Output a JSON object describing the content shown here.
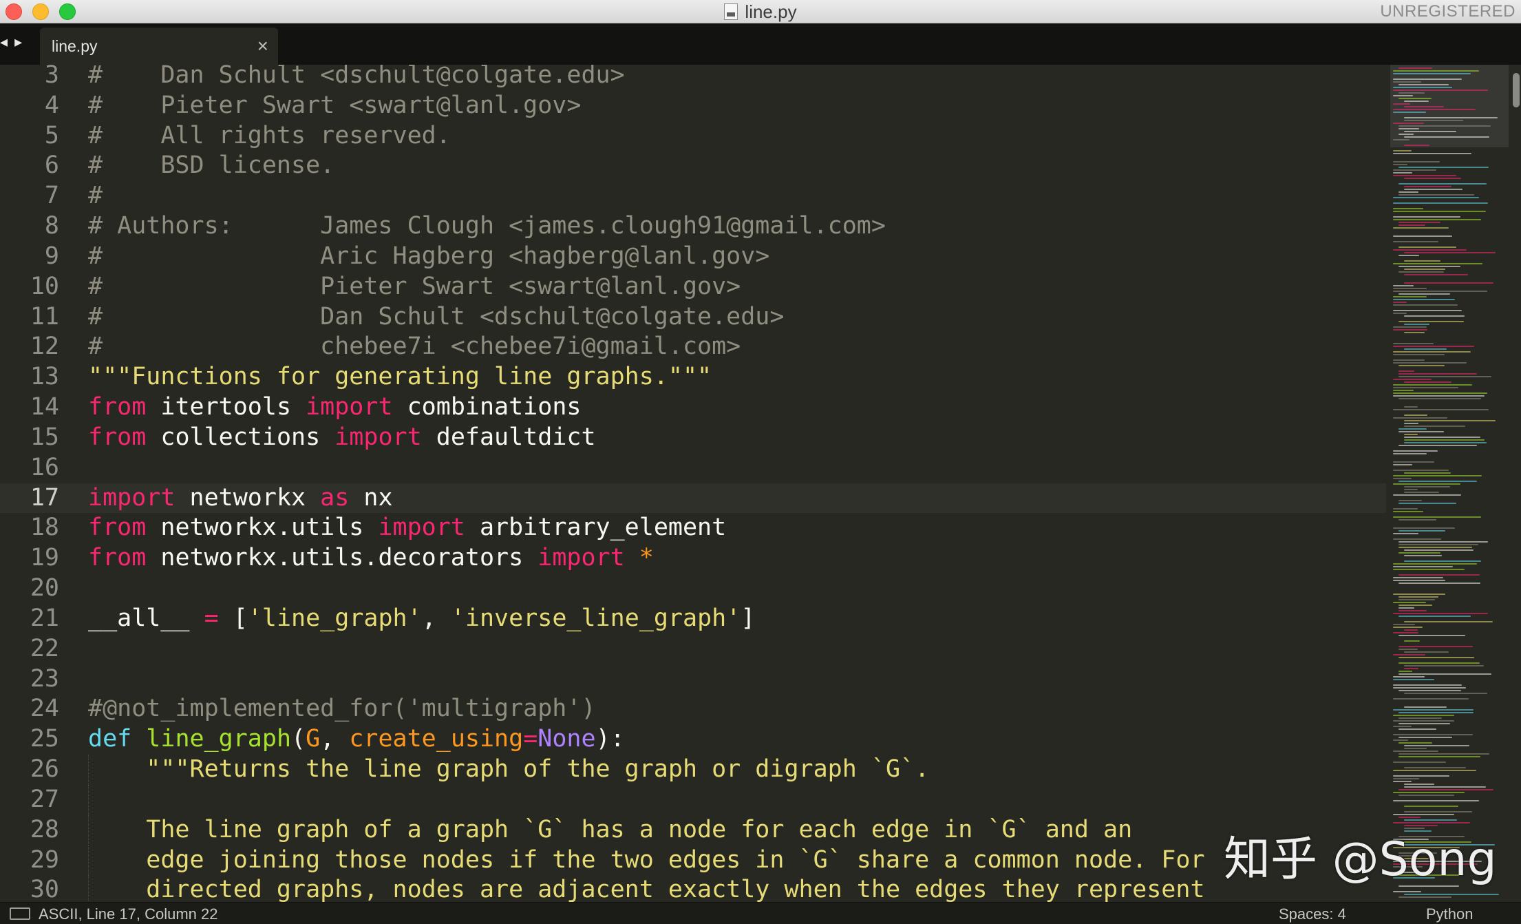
{
  "window": {
    "title": "line.py",
    "registration": "UNREGISTERED"
  },
  "tabs": [
    {
      "label": "line.py",
      "close": "×",
      "active": true
    }
  ],
  "tab_nav": "◂ ▸",
  "editor": {
    "current_line": 17,
    "lines": [
      {
        "n": "3",
        "t": "#    Dan Schult <dschult@colgate.edu>"
      },
      {
        "n": "4",
        "t": "#    Pieter Swart <swart@lanl.gov>"
      },
      {
        "n": "5",
        "t": "#    All rights reserved."
      },
      {
        "n": "6",
        "t": "#    BSD license."
      },
      {
        "n": "7",
        "t": "#"
      },
      {
        "n": "8",
        "t": "# Authors:      James Clough <james.clough91@gmail.com>"
      },
      {
        "n": "9",
        "t": "#               Aric Hagberg <hagberg@lanl.gov>"
      },
      {
        "n": "10",
        "t": "#               Pieter Swart <swart@lanl.gov>"
      },
      {
        "n": "11",
        "t": "#               Dan Schult <dschult@colgate.edu>"
      },
      {
        "n": "12",
        "t": "#               chebee7i <chebee7i@gmail.com>"
      },
      {
        "n": "13",
        "t": "\"\"\"Functions for generating line graphs.\"\"\""
      },
      {
        "n": "14",
        "t": "from itertools import combinations"
      },
      {
        "n": "15",
        "t": "from collections import defaultdict"
      },
      {
        "n": "16",
        "t": ""
      },
      {
        "n": "17",
        "t": "import networkx as nx"
      },
      {
        "n": "18",
        "t": "from networkx.utils import arbitrary_element"
      },
      {
        "n": "19",
        "t": "from networkx.utils.decorators import *"
      },
      {
        "n": "20",
        "t": ""
      },
      {
        "n": "21",
        "t": "__all__ = ['line_graph', 'inverse_line_graph']"
      },
      {
        "n": "22",
        "t": ""
      },
      {
        "n": "23",
        "t": ""
      },
      {
        "n": "24",
        "t": "#@not_implemented_for('multigraph')"
      },
      {
        "n": "25",
        "t": "def line_graph(G, create_using=None):"
      },
      {
        "n": "26",
        "t": "    \"\"\"Returns the line graph of the graph or digraph `G`."
      },
      {
        "n": "27",
        "t": ""
      },
      {
        "n": "28",
        "t": "    The line graph of a graph `G` has a node for each edge in `G` and an"
      },
      {
        "n": "29",
        "t": "    edge joining those nodes if the two edges in `G` share a common node. For"
      },
      {
        "n": "30",
        "t": "    directed graphs, nodes are adjacent exactly when the edges they represent"
      }
    ]
  },
  "status": {
    "left": "ASCII, Line 17, Column 22",
    "indent": "Spaces: 4",
    "syntax": "Python"
  },
  "watermark": "知乎 @Song",
  "colors": {
    "background": "#272822",
    "comment": "#908e80",
    "string": "#e6db74",
    "keyword": "#f92672",
    "function": "#a6e22e",
    "def": "#66d9ef",
    "parameter": "#fd971f",
    "constant": "#ae81ff"
  }
}
